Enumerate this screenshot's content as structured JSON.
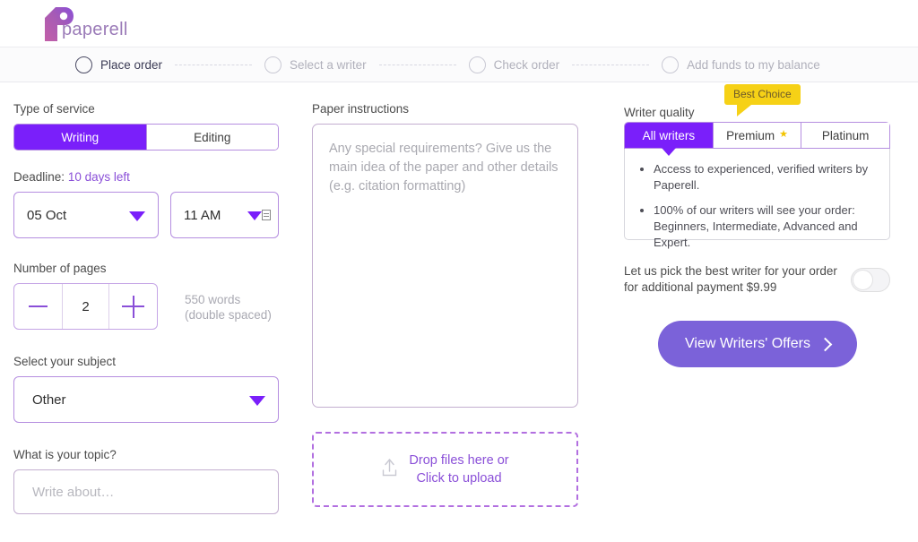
{
  "brand": {
    "logo_word": "paperell",
    "logo_mark": "paperell-p-logo",
    "accent_purple": "#7a1ffa",
    "cta_purple": "#7b62d9",
    "badge_yellow": "#f6d116"
  },
  "steps": [
    {
      "label": "Place order",
      "active": true
    },
    {
      "label": "Select a writer",
      "active": false
    },
    {
      "label": "Check order",
      "active": false
    },
    {
      "label": "Add funds to my balance",
      "active": false
    }
  ],
  "left": {
    "service_label": "Type of service",
    "service_options": [
      "Writing",
      "Editing"
    ],
    "service_selected": "Writing",
    "deadline_label": "Deadline:",
    "deadline_value": "10 days left",
    "date_value": "05 Oct",
    "time_value": "11 AM",
    "pages_label": "Number of pages",
    "pages_value": "2",
    "minus_label": "−",
    "plus_label": "+",
    "words_line1": "550 words",
    "words_line2": "(double spaced)",
    "subject_label": "Select your subject",
    "subject_value": "Other",
    "topic_label": "What is your topic?",
    "topic_value": "",
    "topic_placeholder": "Write about…"
  },
  "middle": {
    "instructions_label": "Paper instructions",
    "instructions_value": "",
    "instructions_placeholder": "Any special requirements? Give us the main idea of the paper and other details (e.g. citation formatting)",
    "drop_line1": "Drop files here or",
    "drop_line2": "Click to upload"
  },
  "right": {
    "quality_label": "Writer quality",
    "best_choice_badge": "Best Choice",
    "tabs": [
      {
        "label": "All writers",
        "active": true,
        "star": false
      },
      {
        "label": "Premium",
        "active": false,
        "star": true
      },
      {
        "label": "Platinum",
        "active": false,
        "star": false
      }
    ],
    "bullets": [
      "Access to experienced, verified writers by Paperell.",
      "100% of our writers will see your order: Beginners, Intermediate, Advanced and Expert."
    ],
    "pick_line1": "Let us pick the best writer for your order",
    "pick_line2": "for additional payment $9.99",
    "toggle_state": "off",
    "cta_label": "View Writers' Offers"
  }
}
